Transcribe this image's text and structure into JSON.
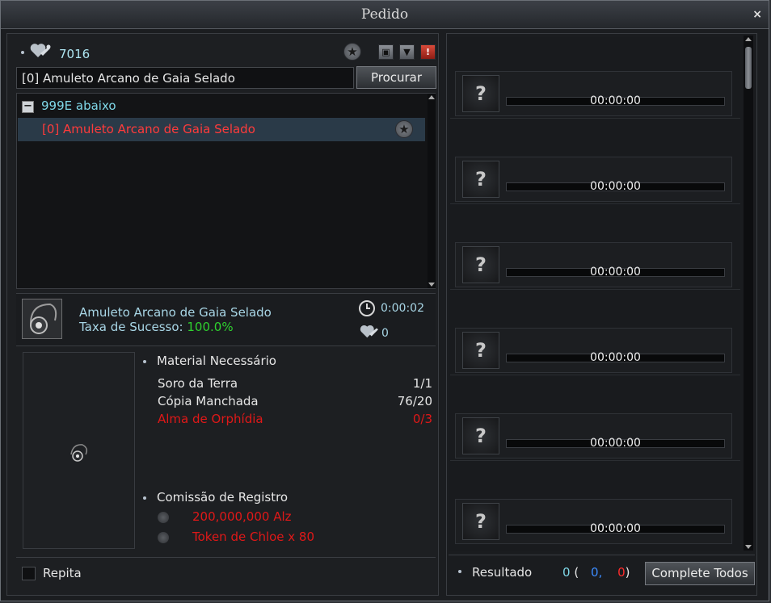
{
  "window": {
    "title": "Pedido",
    "close_label": "×"
  },
  "header": {
    "points": "7016"
  },
  "search": {
    "value": "[0] Amuleto Arcano de Gaia Selado",
    "button_label": "Procurar"
  },
  "tree": {
    "group_toggle": "−",
    "group_label": "999E abaixo",
    "items": [
      {
        "label": "[0] Amuleto Arcano de Gaia Selado"
      }
    ]
  },
  "selected": {
    "name": "Amuleto Arcano de Gaia Selado",
    "success_label": "Taxa de Sucesso:",
    "success_value": "100.0%",
    "time": "0:00:02",
    "points": "0"
  },
  "materials": {
    "header": "Material Necessário",
    "items": [
      {
        "name": "Soro da Terra",
        "count": "1/1",
        "color": "#e6e6e6"
      },
      {
        "name": "Cópia Manchada",
        "count": "76/20",
        "color": "#e6e6e6"
      },
      {
        "name": "Alma de Orphídia",
        "count": "0/3",
        "color": "#e01818"
      }
    ]
  },
  "commission": {
    "header": "Comissão de Registro",
    "options": [
      {
        "label": "200,000,000 Alz"
      },
      {
        "label": "Token de Chloe x 80"
      }
    ]
  },
  "repeat": {
    "label": "Repita",
    "checked": false
  },
  "slots": [
    {
      "placeholder": "?",
      "time": "00:00:00"
    },
    {
      "placeholder": "?",
      "time": "00:00:00"
    },
    {
      "placeholder": "?",
      "time": "00:00:00"
    },
    {
      "placeholder": "?",
      "time": "00:00:00"
    },
    {
      "placeholder": "?",
      "time": "00:00:00"
    },
    {
      "placeholder": "?",
      "time": "00:00:00"
    }
  ],
  "result": {
    "label": "Resultado",
    "total": "0",
    "open": "(",
    "success": "0,",
    "fail": "0",
    "close": ")",
    "complete_all_label": "Complete Todos"
  },
  "colors": {
    "accent_cyan": "#7fd8e8",
    "success_green": "#2fd12f",
    "error_red": "#e01818"
  }
}
